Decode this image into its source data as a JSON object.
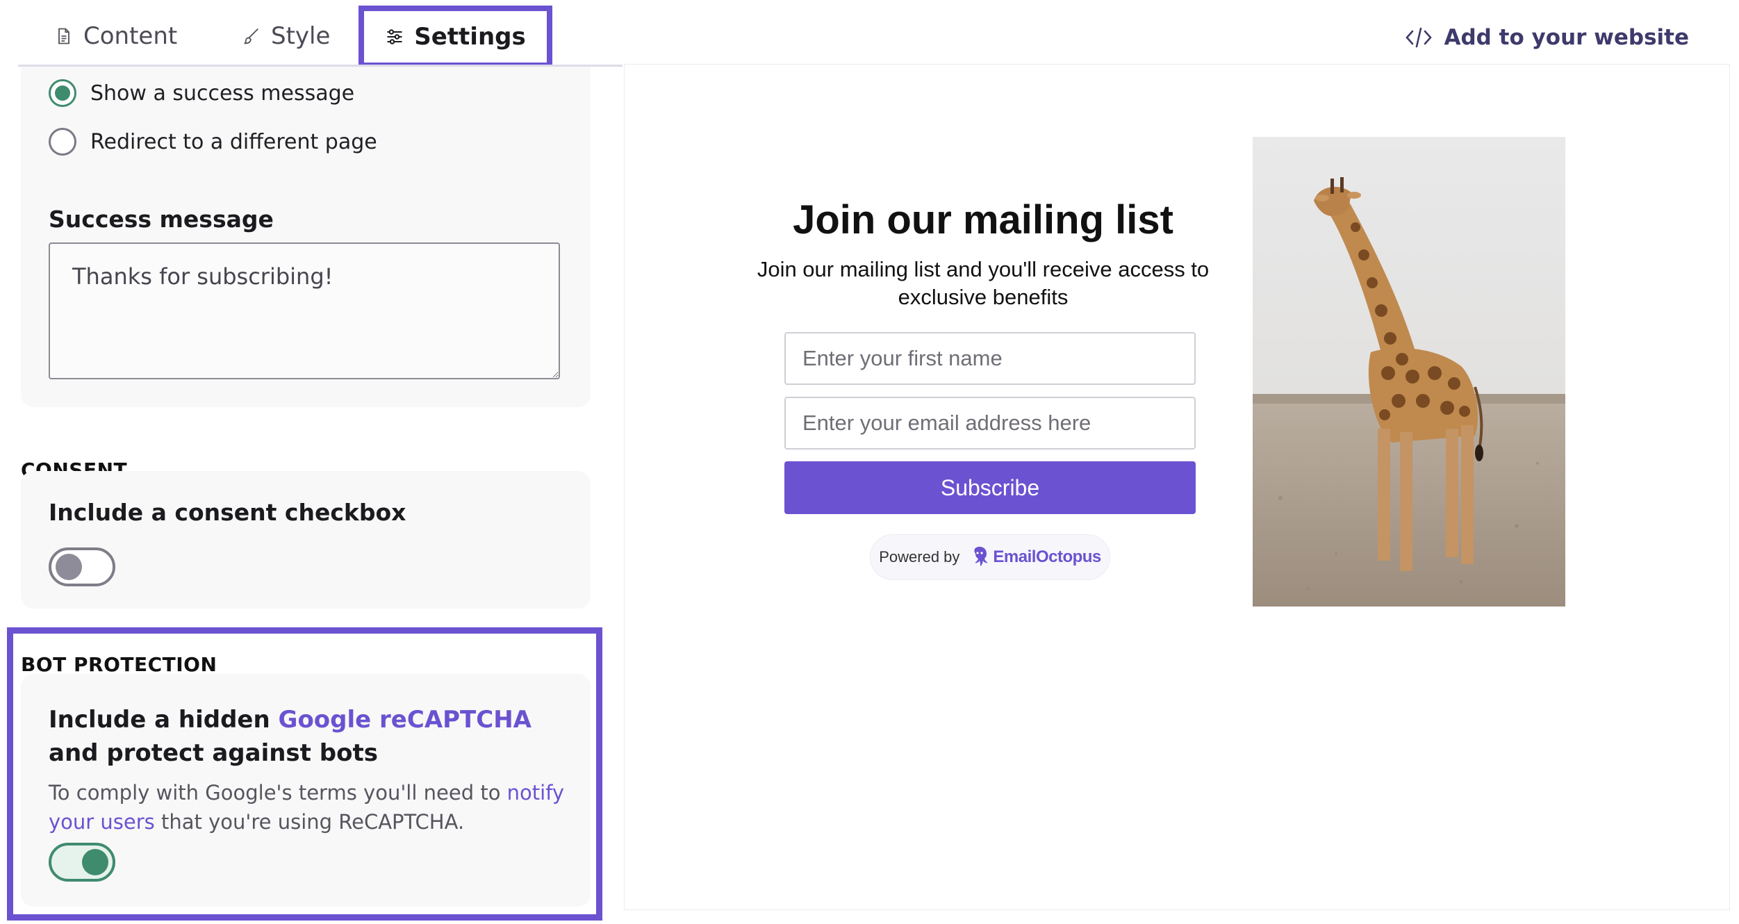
{
  "tabs": {
    "content": "Content",
    "style": "Style",
    "settings": "Settings"
  },
  "add_to_website": "Add to your website",
  "after_submit": {
    "options": [
      {
        "label": "Show a success message",
        "checked": true
      },
      {
        "label": "Redirect to a different page",
        "checked": false
      }
    ]
  },
  "success_message": {
    "label": "Success message",
    "value": "Thanks for subscribing!"
  },
  "consent": {
    "heading": "CONSENT",
    "label": "Include a consent checkbox",
    "enabled": false
  },
  "bot_protection": {
    "heading": "BOT PROTECTION",
    "title_prefix": "Include a hidden ",
    "title_link": "Google reCAPTCHA",
    "title_suffix": " and protect against bots",
    "desc_prefix": "To comply with Google's terms you'll need to ",
    "desc_link": "notify your users",
    "desc_suffix": " that you're using ReCAPTCHA.",
    "enabled": true
  },
  "preview": {
    "title": "Join our mailing list",
    "subtitle": "Join our mailing list and you'll receive access to exclusive benefits",
    "first_name_placeholder": "Enter your first name",
    "email_placeholder": "Enter your email address here",
    "subscribe_label": "Subscribe",
    "powered_by": "Powered by",
    "brand": "EmailOctopus"
  },
  "colors": {
    "accent": "#6b52d1",
    "toggle_on": "#3f8b6e"
  }
}
